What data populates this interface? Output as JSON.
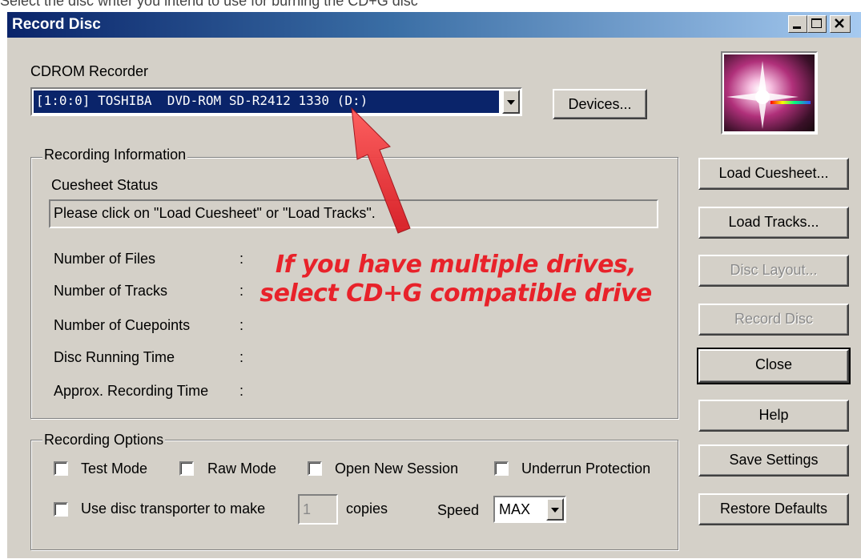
{
  "top_strip_text": "Select the disc writer you intend to use for burning the CD+G disc",
  "window": {
    "title": "Record Disc",
    "minimize_label": "minimize",
    "maximize_label": "maximize",
    "close_label": "close"
  },
  "recorder": {
    "label": "CDROM Recorder",
    "selected_device": "[1:0:0] TOSHIBA  DVD-ROM SD-R2412 1330 (D:)",
    "devices_button": "Devices..."
  },
  "recording_info": {
    "legend": "Recording Information",
    "cuesheet_status_label": "Cuesheet Status",
    "cuesheet_status_value": "Please click on \"Load Cuesheet\" or \"Load Tracks\".",
    "fields": [
      {
        "label": "Number of Files",
        "sep": ":"
      },
      {
        "label": "Number of Tracks",
        "sep": ":"
      },
      {
        "label": "Number of Cuepoints",
        "sep": ":"
      },
      {
        "label": "Disc Running Time",
        "sep": ":"
      },
      {
        "label": "Approx. Recording Time",
        "sep": ":"
      }
    ]
  },
  "recording_options": {
    "legend": "Recording Options",
    "test_mode": "Test Mode",
    "raw_mode": "Raw Mode",
    "open_new_session": "Open New Session",
    "underrun_protection": "Underrun Protection",
    "use_transporter": "Use disc transporter to make",
    "copies_value": "1",
    "copies_label": "copies",
    "speed_label": "Speed",
    "speed_value": "MAX"
  },
  "side_buttons": {
    "load_cuesheet": "Load Cuesheet...",
    "load_tracks": "Load Tracks...",
    "disc_layout": "Disc Layout...",
    "record_disc": "Record Disc",
    "close": "Close",
    "help": "Help",
    "save_settings": "Save Settings",
    "restore_defaults": "Restore Defaults"
  },
  "annotation": {
    "line1": "If you have multiple drives,",
    "line2": "select CD+G compatible drive",
    "color": "#e8222a"
  },
  "colors": {
    "title_start": "#0a246a",
    "title_end": "#a6caf0",
    "face": "#d4d0c8",
    "selection": "#0a246a"
  }
}
